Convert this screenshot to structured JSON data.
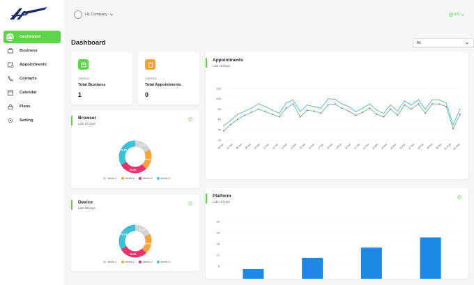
{
  "sidebar": {
    "items": [
      {
        "label": "Dashboard",
        "icon": "home-icon",
        "active": true
      },
      {
        "label": "Business",
        "icon": "briefcase-icon",
        "active": false
      },
      {
        "label": "Appointments",
        "icon": "calendar-clock-icon",
        "active": false
      },
      {
        "label": "Contacts",
        "icon": "phone-icon",
        "active": false
      },
      {
        "label": "Calendar",
        "icon": "calendar-icon",
        "active": false
      },
      {
        "label": "Plans",
        "icon": "lock-icon",
        "active": false
      },
      {
        "label": "Setting",
        "icon": "gear-icon",
        "active": false
      }
    ]
  },
  "header": {
    "company": "HL Company",
    "language": "EN"
  },
  "page": {
    "title": "Dashboard",
    "filter_value": "All"
  },
  "colors": {
    "accent": "#5dd44a",
    "orange": "#f7a23b",
    "series1": "#d3d3d3",
    "series2": "#f7a23b",
    "series3": "#e8336e",
    "series4": "#3bc1d8",
    "bar": "#1e88e5"
  },
  "stats": [
    {
      "caption": "Statistics",
      "title": "Total Business",
      "value": "1",
      "icon": "store-icon"
    },
    {
      "caption": "Statistics",
      "title": "Total Appointments",
      "value": "0",
      "icon": "clipboard-icon"
    }
  ],
  "browser": {
    "title": "Browser",
    "subtitle": "Last 15 Days",
    "legend": [
      "series-1",
      "series-2",
      "series-3",
      "series-4"
    ]
  },
  "device": {
    "title": "Device",
    "subtitle": "Last 15 Days",
    "legend": [
      "series-1",
      "series-2",
      "series-3",
      "series-4"
    ]
  },
  "appointments": {
    "title": "Appointments",
    "subtitle": "Last 15 Days"
  },
  "platform": {
    "title": "Platform",
    "subtitle": "Last 15 Days"
  },
  "chart_data": [
    {
      "type": "pie",
      "chart": "browser",
      "labels": [
        "series-1",
        "series-2",
        "series-3",
        "series-4"
      ],
      "values": [
        17.7,
        20.6,
        28.4,
        33.3
      ],
      "value_labels": [
        "17.7%",
        "20.6%",
        "28.4%",
        "33.3%"
      ]
    },
    {
      "type": "pie",
      "chart": "device",
      "labels": [
        "series-1",
        "series-2",
        "series-3",
        "series-4"
      ],
      "values": [
        17.7,
        20.6,
        28.4,
        33.3
      ],
      "value_labels": [
        "17.7%",
        "20.6%",
        "28.4%",
        "33.3%"
      ]
    },
    {
      "type": "line",
      "chart": "appointments",
      "x": [
        "06 Apr",
        "07 Apr",
        "08 Apr",
        "09 Apr",
        "10 Apr",
        "11 Apr",
        "12 Apr",
        "13 Apr",
        "14 Apr",
        "15 Apr",
        "16 Apr",
        "17 Apr",
        "18 Apr",
        "19 Apr",
        "20 Apr",
        "21 Apr",
        "22 Apr",
        "23 Apr",
        "24 Apr",
        "25 Apr",
        "26 Apr",
        "27 Apr",
        "28 Apr",
        "29 Apr",
        "30 Apr",
        "01 May",
        "02 May"
      ],
      "yticks": [
        20,
        40,
        60,
        80,
        100,
        120
      ],
      "ylim": [
        20,
        120
      ],
      "series": [
        {
          "values": [
            48,
            58,
            70,
            76,
            82,
            90,
            85,
            78,
            72,
            92,
            98,
            75,
            88,
            85,
            82,
            100,
            99,
            90,
            85,
            75,
            82,
            90,
            78,
            72,
            88,
            76,
            96,
            88,
            98,
            80,
            98,
            98,
            92,
            50,
            80
          ]
        },
        {
          "values": [
            38,
            50,
            60,
            68,
            74,
            80,
            75,
            70,
            65,
            82,
            90,
            65,
            78,
            76,
            72,
            88,
            90,
            82,
            76,
            68,
            74,
            82,
            70,
            65,
            80,
            68,
            88,
            80,
            90,
            72,
            90,
            90,
            85,
            42,
            70
          ]
        }
      ]
    },
    {
      "type": "bar",
      "chart": "platform",
      "categories": [
        "",
        "",
        "",
        ""
      ],
      "values": [
        4.5,
        10.5,
        16,
        21.5
      ],
      "yticks": [
        6,
        12,
        18,
        24,
        30
      ],
      "ylim": [
        0,
        30
      ]
    }
  ]
}
